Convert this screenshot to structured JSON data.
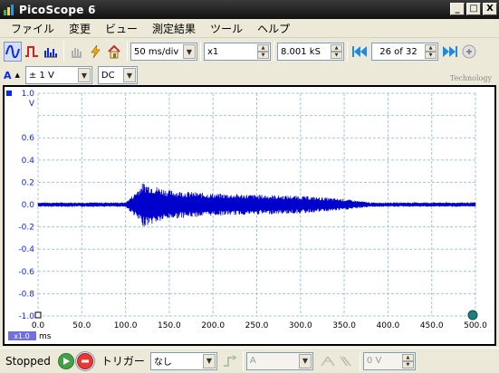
{
  "window": {
    "title": "PicoScope 6",
    "minimize": "_",
    "maximize": "□",
    "close": "X"
  },
  "menu": [
    "ファイル",
    "変更",
    "ビュー",
    "測定結果",
    "ツール",
    "ヘルプ"
  ],
  "toolbar": {
    "timebase": "50 ms/div",
    "zoom": "x1",
    "samples": "8.001 kS",
    "buffer_position": "26 of 32"
  },
  "channel": {
    "name": "A",
    "range": "± 1 V",
    "coupling": "DC"
  },
  "logo_text": "Technology",
  "scope": {
    "y_unit": "V",
    "x_unit": "ms",
    "zoom_badge": "x1.0",
    "y_ticks": [
      "1.0",
      "0.6",
      "0.4",
      "0.2",
      "0.0",
      "-0.2",
      "-0.4",
      "-0.6",
      "-0.8",
      "-1.0"
    ],
    "x_ticks": [
      "0.0",
      "50.0",
      "100.0",
      "150.0",
      "200.0",
      "250.0",
      "300.0",
      "350.0",
      "400.0",
      "450.0",
      "500.0"
    ],
    "trace_color": "#0000cc",
    "grid_color": "#9cc8e0"
  },
  "chart_data": {
    "type": "line",
    "xlabel": "ms",
    "ylabel": "V",
    "xlim": [
      0,
      500
    ],
    "ylim": [
      -1.0,
      1.0
    ],
    "grid": true,
    "series": [
      {
        "envelope": [
          {
            "x": 0,
            "amp": 0.02
          },
          {
            "x": 100,
            "amp": 0.02
          },
          {
            "x": 110,
            "amp": 0.1
          },
          {
            "x": 120,
            "amp": 0.2
          },
          {
            "x": 150,
            "amp": 0.13
          },
          {
            "x": 200,
            "amp": 0.1
          },
          {
            "x": 300,
            "amp": 0.08
          },
          {
            "x": 350,
            "amp": 0.05
          },
          {
            "x": 380,
            "amp": 0.02
          },
          {
            "x": 500,
            "amp": 0.02
          }
        ]
      }
    ]
  },
  "status": {
    "state": "Stopped",
    "trigger_label": "トリガー",
    "trigger_mode": "なし",
    "trigger_channel": "A",
    "trigger_level": "0 V"
  }
}
